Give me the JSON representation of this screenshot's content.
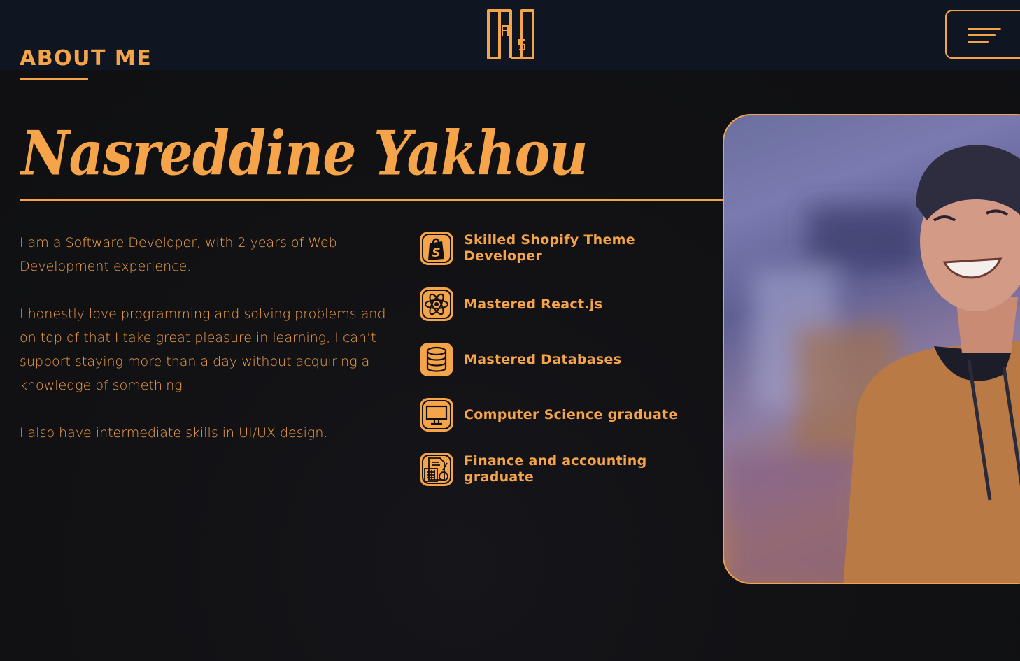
{
  "header": {
    "section_title": "ABOUT ME",
    "logo_icon": "initials-logo-icon",
    "menu_icon": "hamburger-menu-icon"
  },
  "profile": {
    "name": "Nasreddine Yakhou",
    "bio": [
      "I am a Software Developer, with 2 years of Web Development experience.",
      "I honestly love programming and solving problems and on top of that I take great pleasure in learning, I can’t support staying more than a day without acquiring a knowledge of something!",
      "I also have intermediate skills in UI/UX design."
    ],
    "photo_icon": "profile-photo"
  },
  "skills": [
    {
      "label": "Skilled Shopify Theme Developer",
      "icon": "shopify-icon"
    },
    {
      "label": "Mastered React.js",
      "icon": "react-atom-icon"
    },
    {
      "label": "Mastered Databases",
      "icon": "database-icon"
    },
    {
      "label": "Computer Science graduate",
      "icon": "computer-monitor-icon"
    },
    {
      "label": "Finance and accounting graduate",
      "icon": "calculator-document-icon"
    }
  ],
  "colors": {
    "accent": "#f5a44a",
    "background": "#111113",
    "header_background": "#0f1621"
  }
}
